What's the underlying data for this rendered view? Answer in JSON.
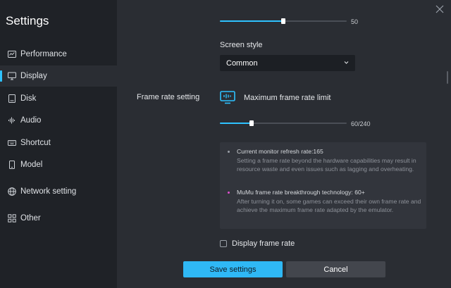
{
  "window": {
    "title": "Settings"
  },
  "sidebar": {
    "items": [
      {
        "label": "Performance",
        "icon": "performance-icon"
      },
      {
        "label": "Display",
        "icon": "monitor-icon",
        "active": true
      },
      {
        "label": "Disk",
        "icon": "disk-icon"
      },
      {
        "label": "Audio",
        "icon": "audio-icon"
      },
      {
        "label": "Shortcut",
        "icon": "keyboard-icon"
      },
      {
        "label": "Model",
        "icon": "phone-icon"
      },
      {
        "label": "Network setting",
        "icon": "globe-icon"
      },
      {
        "label": "Other",
        "icon": "grid-icon"
      }
    ]
  },
  "main": {
    "top_slider": {
      "value_label": "50",
      "fraction": 0.5
    },
    "screen_style": {
      "label": "Screen style",
      "selected": "Common"
    },
    "frame_rate": {
      "section_label": "Frame rate setting",
      "limit_label": "Maximum frame rate limit",
      "value_label": "60/240",
      "fraction": 0.25
    },
    "info": {
      "line1_title": "Current monitor refresh rate:165",
      "line1_desc": "Setting a frame rate beyond the hardware capabilities may result in resource waste and even issues such as lagging and overheating.",
      "line2_title": "MuMu frame rate breakthrough technology: 60+",
      "line2_desc": "After turning it on, some games can exceed their own frame rate and achieve the maximum frame rate adapted by the emulator."
    },
    "display_frame_rate": {
      "label": "Display frame rate",
      "checked": false
    }
  },
  "footer": {
    "save_label": "Save settings",
    "cancel_label": "Cancel"
  },
  "colors": {
    "accent": "#2ec2ff",
    "dot_grey": "#9aa0a8",
    "dot_pink": "#e04fd0"
  }
}
